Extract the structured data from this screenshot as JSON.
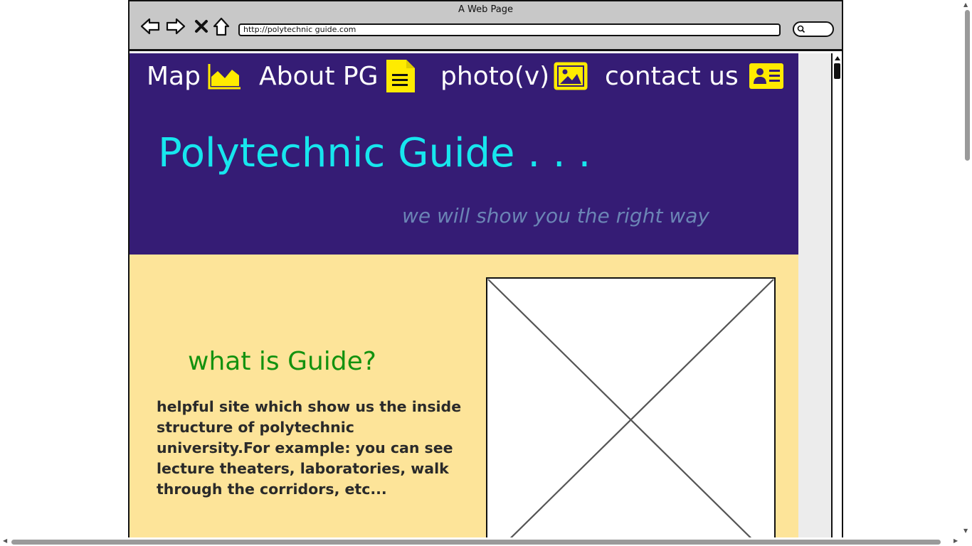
{
  "window": {
    "title": "A Web Page",
    "url": "http://polytechnic guide.com"
  },
  "nav": {
    "items": [
      {
        "label": "Map",
        "icon": "map-icon"
      },
      {
        "label": "About PG",
        "icon": "document-icon"
      },
      {
        "label": "photo(v)",
        "icon": "image-icon"
      },
      {
        "label": "contact us",
        "icon": "contact-card-icon"
      }
    ]
  },
  "hero": {
    "title": "Polytechnic Guide . . .",
    "tagline": "we will show you the right way"
  },
  "about": {
    "heading": "what is Guide?",
    "text": "helpful site which show us the inside structure of polytechnic university.For example: you can see lecture theaters, laboratories, walk through the corridors, etc..."
  },
  "colors": {
    "hero_bg": "#351c75",
    "title": "#17e6ee",
    "tagline": "#6b85b5",
    "about_bg": "#fde499",
    "heading": "#13920f",
    "icon_yellow": "#ffeb00"
  }
}
